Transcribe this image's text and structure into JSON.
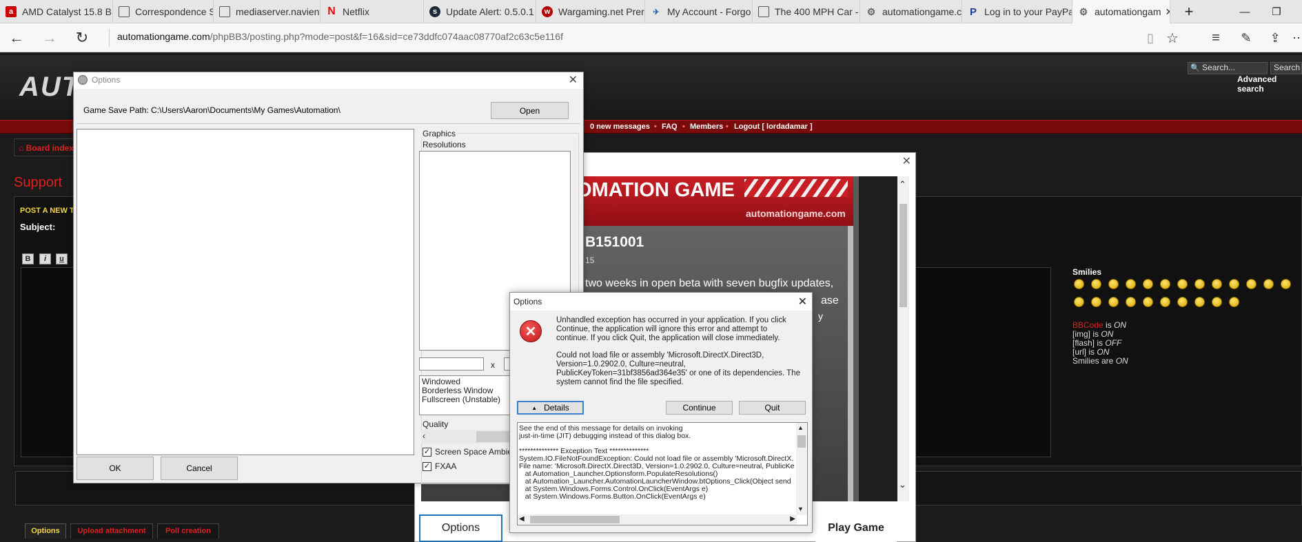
{
  "browser": {
    "tabs": [
      {
        "label": "AMD Catalyst 15.8 B",
        "icon": "amd-icon"
      },
      {
        "label": "Correspondence Sur",
        "icon": "page-icon"
      },
      {
        "label": "mediaserver.navient.",
        "icon": "page-icon"
      },
      {
        "label": "Netflix",
        "icon": "netflix-icon"
      },
      {
        "label": "Update Alert: 0.5.0.1",
        "icon": "steam-icon"
      },
      {
        "label": "Wargaming.net Prer",
        "icon": "wargaming-icon"
      },
      {
        "label": "My Account - Forgo",
        "icon": "forgotten-icon"
      },
      {
        "label": "The 400 MPH Car - /",
        "icon": "page-icon"
      },
      {
        "label": "automationgame.co",
        "icon": "gear-icon"
      },
      {
        "label": "Log in to your PayPa",
        "icon": "paypal-icon"
      },
      {
        "label": "automationgam",
        "icon": "gear-icon",
        "active": true
      }
    ],
    "url_domain": "automationgame.com",
    "url_path": "/phpBB3/posting.php?mode=post&f=16&sid=ce73ddfc074aac08770af2c63c5e116f"
  },
  "forum": {
    "logo_text": "AUT",
    "search_placeholder": "Search...",
    "search_button": "Search",
    "advanced_search": "Advanced search",
    "nav_links": [
      "0 new messages",
      "FAQ",
      "Members",
      "Logout [ lordadamar ]"
    ],
    "board_index": "Board index",
    "section_title": "Support",
    "post_heading": "POST A NEW TO",
    "subject_label": "Subject:",
    "format_buttons": [
      "B",
      "i",
      "u"
    ],
    "smilies_heading": "Smilies",
    "bbcode_status": [
      {
        "label": "BBCode",
        "state": "ON",
        "prefix": "",
        "suffix": " is "
      },
      {
        "label": "[img]",
        "state": "ON",
        "prefix": "",
        "suffix": " is "
      },
      {
        "label": "[flash]",
        "state": "OFF",
        "prefix": "",
        "suffix": " is "
      },
      {
        "label": "[url]",
        "state": "ON",
        "prefix": "",
        "suffix": " is "
      },
      {
        "label": "Smilies",
        "state": "ON",
        "prefix": "",
        "suffix": " are "
      }
    ],
    "bottom_tabs": [
      "Options",
      "Upload attachment",
      "Poll creation"
    ]
  },
  "launcher": {
    "banner_title": "OMATION GAME",
    "banner_site": "automationgame.com",
    "version": "B151001",
    "subline": "15",
    "news_line1": "two weeks in open beta with seven bugfix updates,",
    "news_line2": "ase",
    "news_line3": "y",
    "options_button": "Options",
    "play_button": "Play Game"
  },
  "options_dialog": {
    "title": "Options",
    "save_path_label": "Game Save Path: C:\\Users\\Aaron\\Documents\\My Games\\Automation\\",
    "open_button": "Open",
    "graphics_label": "Graphics",
    "resolutions_label": "Resolutions",
    "res_x": "x",
    "window_modes": [
      "Windowed",
      "Borderless Window",
      "Fullscreen (Unstable)"
    ],
    "quality_label": "Quality",
    "checkboxes": [
      {
        "label": "Screen Space Ambient",
        "checked": true
      },
      {
        "label": "FXAA",
        "checked": true
      }
    ],
    "ok_button": "OK",
    "cancel_button": "Cancel"
  },
  "error_dialog": {
    "title": "Options",
    "message1": "Unhandled exception has occurred in your application. If you click Continue, the application will ignore this error and attempt to continue. If you click Quit, the application will close immediately.",
    "message2": "Could not load file or assembly 'Microsoft.DirectX.Direct3D, Version=1.0.2902.0, Culture=neutral, PublicKeyToken=31bf3856ad364e35' or one of its dependencies. The system cannot find the file specified.",
    "details_button": "Details",
    "continue_button": "Continue",
    "quit_button": "Quit",
    "details_lines": [
      "See the end of this message for details on invoking",
      "just-in-time (JIT) debugging instead of this dialog box.",
      "",
      "************** Exception Text **************",
      "System.IO.FileNotFoundException: Could not load file or assembly 'Microsoft.DirectX.",
      "File name: 'Microsoft.DirectX.Direct3D, Version=1.0.2902.0, Culture=neutral, PublicKe",
      "   at Automation_Launcher.Optionsform.PopulateResolutions()",
      "   at Automation_Launcher.AutomationLauncherWindow.btOptions_Click(Object send",
      "   at System.Windows.Forms.Control.OnClick(EventArgs e)",
      "   at System.Windows.Forms.Button.OnClick(EventArgs e)"
    ]
  },
  "colors": {
    "forum_red": "#c0151c",
    "forum_yellow": "#f5d742",
    "error_red": "#d42424",
    "details_focus": "#3c7fd6"
  }
}
